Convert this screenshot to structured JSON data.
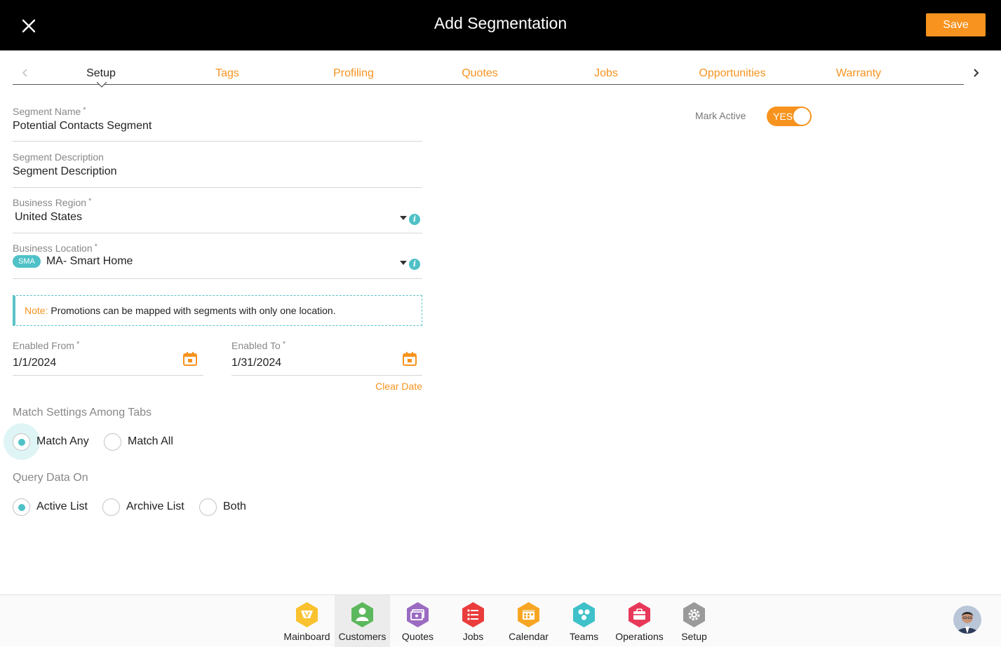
{
  "header": {
    "title": "Add Segmentation",
    "save_label": "Save"
  },
  "tabs": [
    {
      "label": "Setup",
      "active": true
    },
    {
      "label": "Tags"
    },
    {
      "label": "Profiling"
    },
    {
      "label": "Quotes"
    },
    {
      "label": "Jobs"
    },
    {
      "label": "Opportunities"
    },
    {
      "label": "Warranty"
    }
  ],
  "form": {
    "segment_name": {
      "label": "Segment Name",
      "required": "*",
      "value": "Potential Contacts Segment"
    },
    "segment_description": {
      "label": "Segment Description",
      "value": "Segment Description"
    },
    "business_region": {
      "label": "Business Region",
      "required": "*",
      "value": "United States"
    },
    "business_location": {
      "label": "Business Location",
      "required": "*",
      "badge": "SMA",
      "value": "MA- Smart Home"
    },
    "note": {
      "label": "Note:",
      "text": " Promotions can be mapped with segments with only one location."
    },
    "enabled_from": {
      "label": "Enabled From",
      "required": "*",
      "value": "1/1/2024"
    },
    "enabled_to": {
      "label": "Enabled To",
      "required": "*",
      "value": "1/31/2024"
    },
    "clear_date": "Clear Date",
    "match_settings": {
      "title": "Match Settings Among Tabs",
      "options": [
        "Match Any",
        "Match All"
      ],
      "selected": "Match Any"
    },
    "query_data": {
      "title": "Query Data On",
      "options": [
        "Active List",
        "Archive List",
        "Both"
      ],
      "selected": "Active List"
    }
  },
  "mark_active": {
    "label": "Mark Active",
    "value": "YES"
  },
  "bottom_nav": [
    {
      "label": "Mainboard",
      "color": "#f9c22e",
      "icon": "mainboard-icon"
    },
    {
      "label": "Customers",
      "color": "#5cb85c",
      "icon": "customer-icon",
      "active": true
    },
    {
      "label": "Quotes",
      "color": "#9b6bc2",
      "icon": "quotes-icon"
    },
    {
      "label": "Jobs",
      "color": "#ea3c3c",
      "icon": "jobs-icon"
    },
    {
      "label": "Calendar",
      "color": "#f7a623",
      "icon": "calendar-icon"
    },
    {
      "label": "Teams",
      "color": "#3ec1c9",
      "icon": "teams-icon"
    },
    {
      "label": "Operations",
      "color": "#e8385a",
      "icon": "operations-icon"
    },
    {
      "label": "Setup",
      "color": "#9a9a9a",
      "icon": "gear-icon"
    }
  ],
  "colors": {
    "accent": "#f7931e",
    "teal": "#4fc1c7",
    "header_bg": "#000000"
  }
}
